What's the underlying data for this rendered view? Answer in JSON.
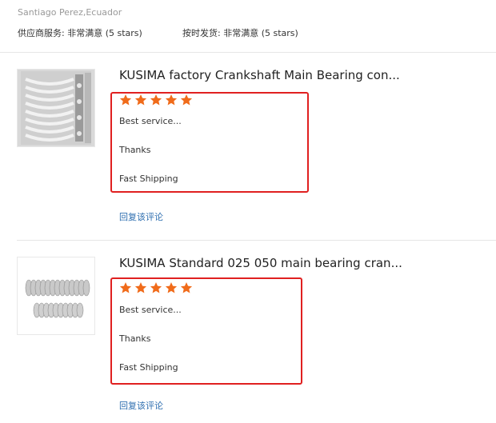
{
  "header": {
    "author": "Santiago Perez,Ecuador",
    "supplier_service": "供应商服务: 非常满意 (5 stars)",
    "on_time_shipment": "按时发货: 非常满意 (5 stars)"
  },
  "reviews": [
    {
      "title": "KUSIMA factory Crankshaft Main Bearing con...",
      "stars": 5,
      "lines": [
        "Best service...",
        "Thanks",
        "Fast Shipping"
      ],
      "reply": "回复该评论"
    },
    {
      "title": "KUSIMA Standard 025 050 main bearing cran...",
      "stars": 5,
      "lines": [
        "Best service...",
        "Thanks",
        "Fast Shipping"
      ],
      "reply": "回复该评论"
    }
  ],
  "colors": {
    "star": "#f06b1a",
    "highlight_border": "#e02020",
    "link": "#2f6fb0"
  },
  "icons": {
    "star": "star-icon"
  }
}
